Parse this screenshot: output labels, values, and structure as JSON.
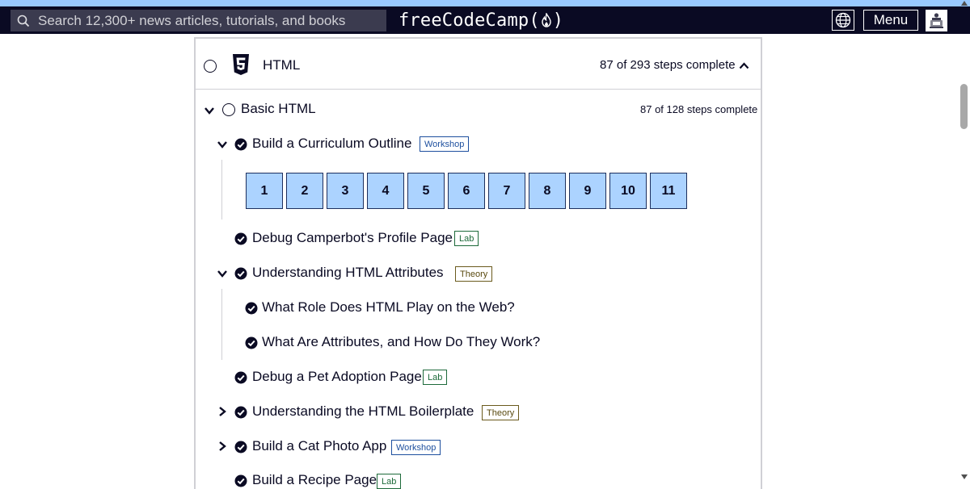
{
  "navbar": {
    "search_placeholder": "Search 12,300+ news articles, tutorials, and books",
    "brand_prefix": "freeCodeCamp(",
    "brand_suffix": ")",
    "menu_label": "Menu"
  },
  "cert": {
    "title": "HTML",
    "progress": "87 of 293 steps complete"
  },
  "module": {
    "title": "Basic HTML",
    "progress": "87 of 128 steps complete"
  },
  "blocks": [
    {
      "title": "Build a Curriculum Outline",
      "badge": "Workshop"
    },
    {
      "title": "Debug Camperbot's Profile Page",
      "badge": "Lab"
    },
    {
      "title": "Understanding HTML Attributes",
      "badge": "Theory"
    },
    {
      "title": "Debug a Pet Adoption Page",
      "badge": "Lab"
    },
    {
      "title": "Understanding the HTML Boilerplate",
      "badge": "Theory"
    },
    {
      "title": "Build a Cat Photo App",
      "badge": "Workshop"
    },
    {
      "title": "Build a Recipe Page",
      "badge": "Lab"
    }
  ],
  "steps": [
    "1",
    "2",
    "3",
    "4",
    "5",
    "6",
    "7",
    "8",
    "9",
    "10",
    "11"
  ],
  "lessons": [
    "What Role Does HTML Play on the Web?",
    "What Are Attributes, and How Do They Work?"
  ],
  "colors": {
    "nav_bg": "#0a0a23",
    "search_bg": "#3b3b4f",
    "step_bg": "#acd3ff",
    "accent": "#99c9ff"
  }
}
